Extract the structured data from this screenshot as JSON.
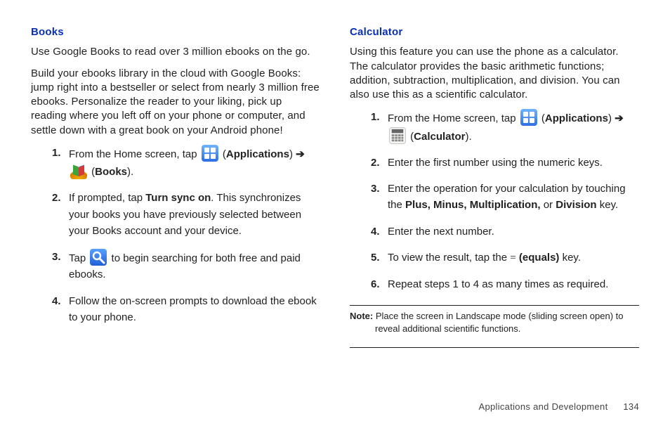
{
  "left": {
    "heading": "Books",
    "p1": "Use Google Books to read over 3 million ebooks on the go.",
    "p2": "Build your ebooks library in the cloud with Google Books: jump right into a bestseller or select from nearly 3 million free ebooks. Personalize the reader to your liking, pick up reading where you left off on your phone or computer, and settle down with a great book on your Android phone!",
    "step1_a": "From the Home screen, tap ",
    "apps_label": "Applications",
    "books_label": "Books",
    "step2_a": "If prompted, tap ",
    "step2_b": "Turn sync on",
    "step2_c": ". This synchronizes your books you have previously selected between your Books account and your device.",
    "step3_a": "Tap ",
    "step3_b": " to begin searching for both free and paid ebooks.",
    "step4": "Follow the on-screen prompts to download the ebook to your phone."
  },
  "right": {
    "heading": "Calculator",
    "p1": "Using this feature you can use the phone as a calculator. The calculator provides the basic arithmetic functions; addition, subtraction, multiplication, and division. You can also use this as a scientific calculator.",
    "step1_a": "From the Home screen, tap ",
    "apps_label": "Applications",
    "calc_label": "Calculator",
    "step2": "Enter the first number using the numeric keys.",
    "step3_a": "Enter the operation for your calculation by touching the ",
    "step3_b": "Plus, Minus, Multiplication,",
    "step3_or": " or ",
    "step3_c": "Division",
    "step3_end": " key.",
    "step4": "Enter the next number.",
    "step5_a": "To view the result, tap the ",
    "step5_eq": "=",
    "step5_b": " (equals)",
    "step5_end": " key.",
    "step6": "Repeat steps 1 to 4 as many times as required.",
    "note_label": "Note: ",
    "note_text": "Place the screen in Landscape mode (sliding screen open) to reveal additional scientific functions."
  },
  "footer": {
    "section": "Applications and Development",
    "page": "134"
  },
  "glyphs": {
    "arrow": "➔",
    "open_paren": "(",
    "close_paren": ")",
    "close_paren_arrow": ") "
  }
}
